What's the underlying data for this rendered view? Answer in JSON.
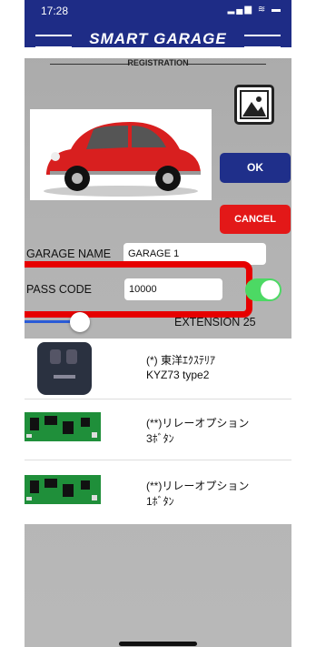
{
  "status": {
    "time": "17:28",
    "icons": "▂▄▆ ≋ ▬"
  },
  "app": {
    "title": "SMART GARAGE",
    "subtitle": "REGISTRATION"
  },
  "buttons": {
    "ok": "OK",
    "cancel": "CANCEL"
  },
  "form": {
    "garage_name_label": "GARAGE NAME",
    "garage_name_value": "GARAGE 1",
    "pass_code_label": "PASS CODE",
    "pass_code_value": "10000",
    "extension_text": "EXTENSION 25"
  },
  "devices": [
    {
      "line1": "(*) 東洋ｴｸｽﾃﾘｱ",
      "line2": "KYZ73 type2",
      "icon": "remote-control-icon"
    },
    {
      "line1": "(**)リレーオプション",
      "line2": "3ﾎﾞﾀﾝ",
      "icon": "relay-board-icon"
    },
    {
      "line1": "(**)リレーオプション",
      "line2": "1ﾎﾞﾀﾝ",
      "icon": "relay-board-icon"
    }
  ],
  "colors": {
    "accent": "#1f2f8a",
    "danger": "#e31818",
    "toggle_on": "#4cd964"
  }
}
